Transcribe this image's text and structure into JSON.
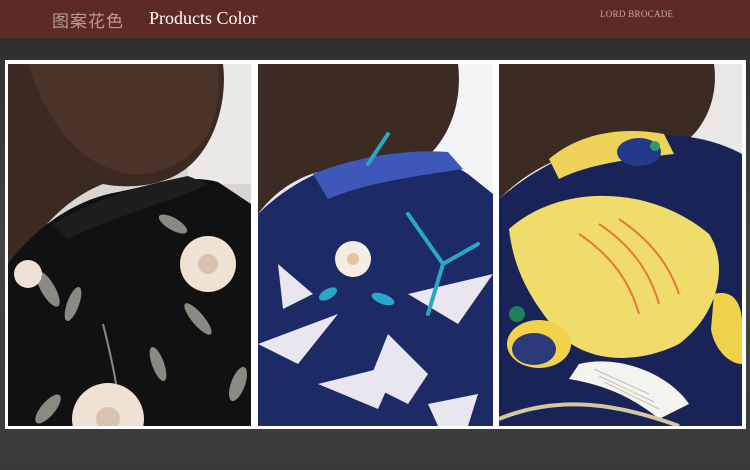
{
  "header": {
    "title_cn": "图案花色",
    "title_en": "Products Color",
    "brand": "LORD BROCADE"
  },
  "photos": [
    {
      "icon": "black-floral-print-shirt-photo"
    },
    {
      "icon": "navy-leaf-print-shirt-photo"
    },
    {
      "icon": "yellow-bird-print-shirt-photo"
    }
  ]
}
